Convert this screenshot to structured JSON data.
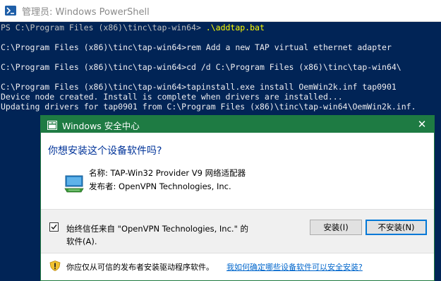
{
  "powershell": {
    "title": "管理员: Windows PowerShell",
    "icon": "powershell-icon",
    "console_lines": [
      {
        "prompt": "PS C:\\Program Files (x86)\\tinc\\tap-win64> ",
        "command": ".\\addtap.bat"
      },
      {
        "text": ""
      },
      {
        "text": "C:\\Program Files (x86)\\tinc\\tap-win64>rem Add a new TAP virtual ethernet adapter"
      },
      {
        "text": ""
      },
      {
        "text": "C:\\Program Files (x86)\\tinc\\tap-win64>cd /d C:\\Program Files (x86)\\tinc\\tap-win64\\"
      },
      {
        "text": ""
      },
      {
        "text": "C:\\Program Files (x86)\\tinc\\tap-win64>tapinstall.exe install OemWin2k.inf tap0901"
      },
      {
        "text": "Device node created. Install is complete when drivers are installed..."
      },
      {
        "text": "Updating drivers for tap0901 from C:\\Program Files (x86)\\tinc\\tap-win64\\OemWin2k.inf."
      }
    ]
  },
  "dialog": {
    "title": "Windows 安全中心",
    "close_icon": "close-icon",
    "question": "你想安装这个设备软件吗?",
    "device_name": "名称: TAP-Win32 Provider V9 网络适配器",
    "publisher": "发布者: OpenVPN Technologies, Inc.",
    "trust_checkbox": {
      "checked": true,
      "label_line1": "始终信任来自 \"OpenVPN Technologies, Inc.\" 的",
      "label_line2": "软件(A)."
    },
    "install_button": "安装(I)",
    "dont_install_button": "不安装(N)",
    "warning_text": "你应仅从可信的发布者安装驱动程序软件。",
    "warning_link": "我如何确定哪些设备软件可以安全安装?"
  },
  "colors": {
    "console_bg": "#012456",
    "dialog_titlebar": "#1e7b43",
    "question_text": "#003399",
    "link": "#0066cc"
  }
}
